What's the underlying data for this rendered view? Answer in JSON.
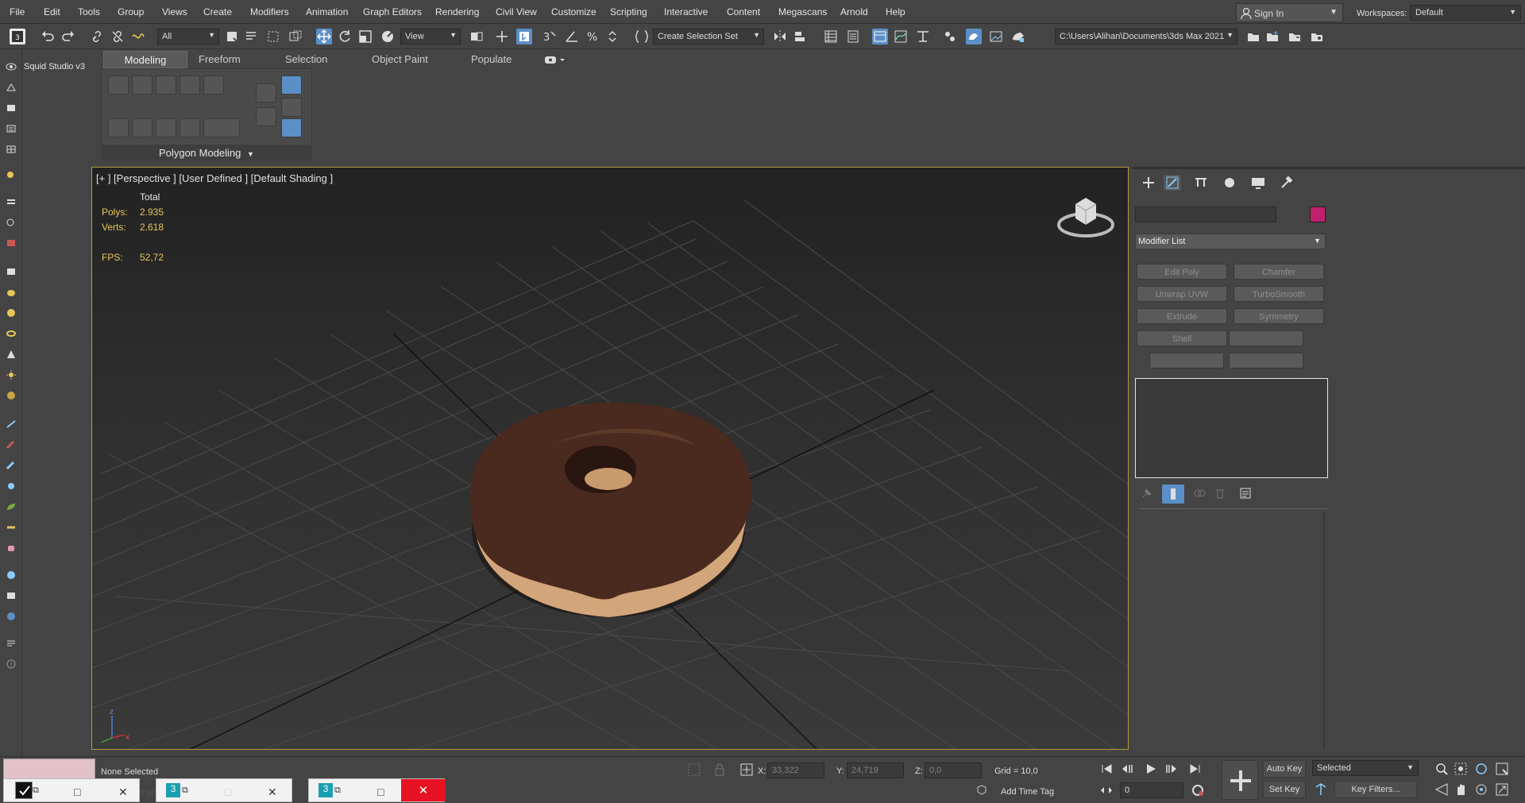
{
  "menubar": {
    "items": [
      "File",
      "Edit",
      "Tools",
      "Group",
      "Views",
      "Create",
      "Modifiers",
      "Animation",
      "Graph Editors",
      "Rendering",
      "Civil View",
      "Customize",
      "Scripting",
      "Interactive",
      "Content",
      "Megascans",
      "Arnold",
      "Help"
    ],
    "sign_in": "Sign In",
    "workspaces_label": "Workspaces:",
    "workspace_value": "Default"
  },
  "toolbar": {
    "selection_filter": "All",
    "ref_coord": "View",
    "selection_set": "Create Selection Set",
    "project_path": "C:\\Users\\Alihan\\Documents\\3ds Max 2021"
  },
  "ribbon": {
    "tabs": [
      "Modeling",
      "Freeform",
      "Selection",
      "Object Paint",
      "Populate"
    ],
    "panel_label": "Polygon Modeling"
  },
  "left_panel": {
    "plugin_label": "Squid Studio v3"
  },
  "viewport": {
    "label": "[+ ] [Perspective ] [User Defined ] [Default Shading ]",
    "stats_header": "Total",
    "polys_label": "Polys:",
    "polys_value": "2.935",
    "verts_label": "Verts:",
    "verts_value": "2.618",
    "fps_label": "FPS:",
    "fps_value": "52,72",
    "axis_z": "z",
    "axis_x": "x"
  },
  "command_panel": {
    "color_swatch": "#c2206e",
    "modifier_list": "Modifier List",
    "modifiers": [
      "Edit Poly",
      "Chamfer",
      "Unwrap UVW",
      "TurboSmooth",
      "Extrude",
      "Symmetry",
      "Shell"
    ]
  },
  "statusbar": {
    "selection_status": "None Selected",
    "x_label": "X:",
    "x_value": "33,322",
    "y_label": "Y:",
    "y_value": "24,719",
    "z_label": "Z:",
    "z_value": "0,0",
    "grid": "Grid = 10,0",
    "add_time_tag": "Add Time Tag",
    "frame": "0",
    "auto_key": "Auto Key",
    "set_key": "Set Key",
    "key_mode": "Selected",
    "key_filters": "Key Filters..."
  },
  "taskbar": {
    "partial_text": "n pr"
  },
  "colors": {
    "accent_blue": "#5b8fc7",
    "viewport_border": "#b59b3a",
    "stats_yellow": "#e8c65a",
    "close_red": "#e81123"
  }
}
